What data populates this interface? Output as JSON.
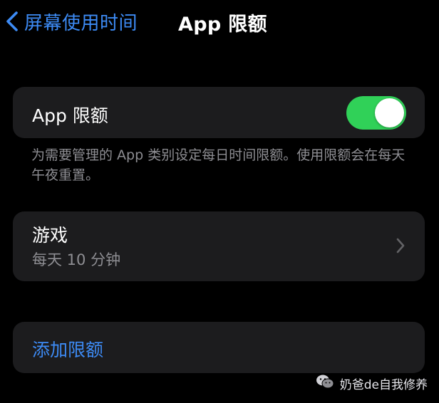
{
  "nav": {
    "back_label": "屏幕使用时间",
    "title": "App 限额"
  },
  "toggle_row": {
    "label": "App 限额",
    "enabled": true
  },
  "footer_note": "为需要管理的 App 类别设定每日时间限额。使用限额会在每天午夜重置。",
  "category_row": {
    "name": "游戏",
    "limit": "每天 10 分钟"
  },
  "add_row": {
    "label": "添加限额"
  },
  "watermark": {
    "text": "奶爸de自我修养"
  },
  "colors": {
    "background": "#000000",
    "card": "#1c1c1e",
    "accent_blue": "#3d8bf5",
    "toggle_on": "#30d158",
    "secondary_text": "#8e8e93"
  },
  "icons": {
    "back": "chevron-left-icon",
    "row_disclosure": "chevron-right-icon",
    "watermark": "wechat-icon"
  }
}
